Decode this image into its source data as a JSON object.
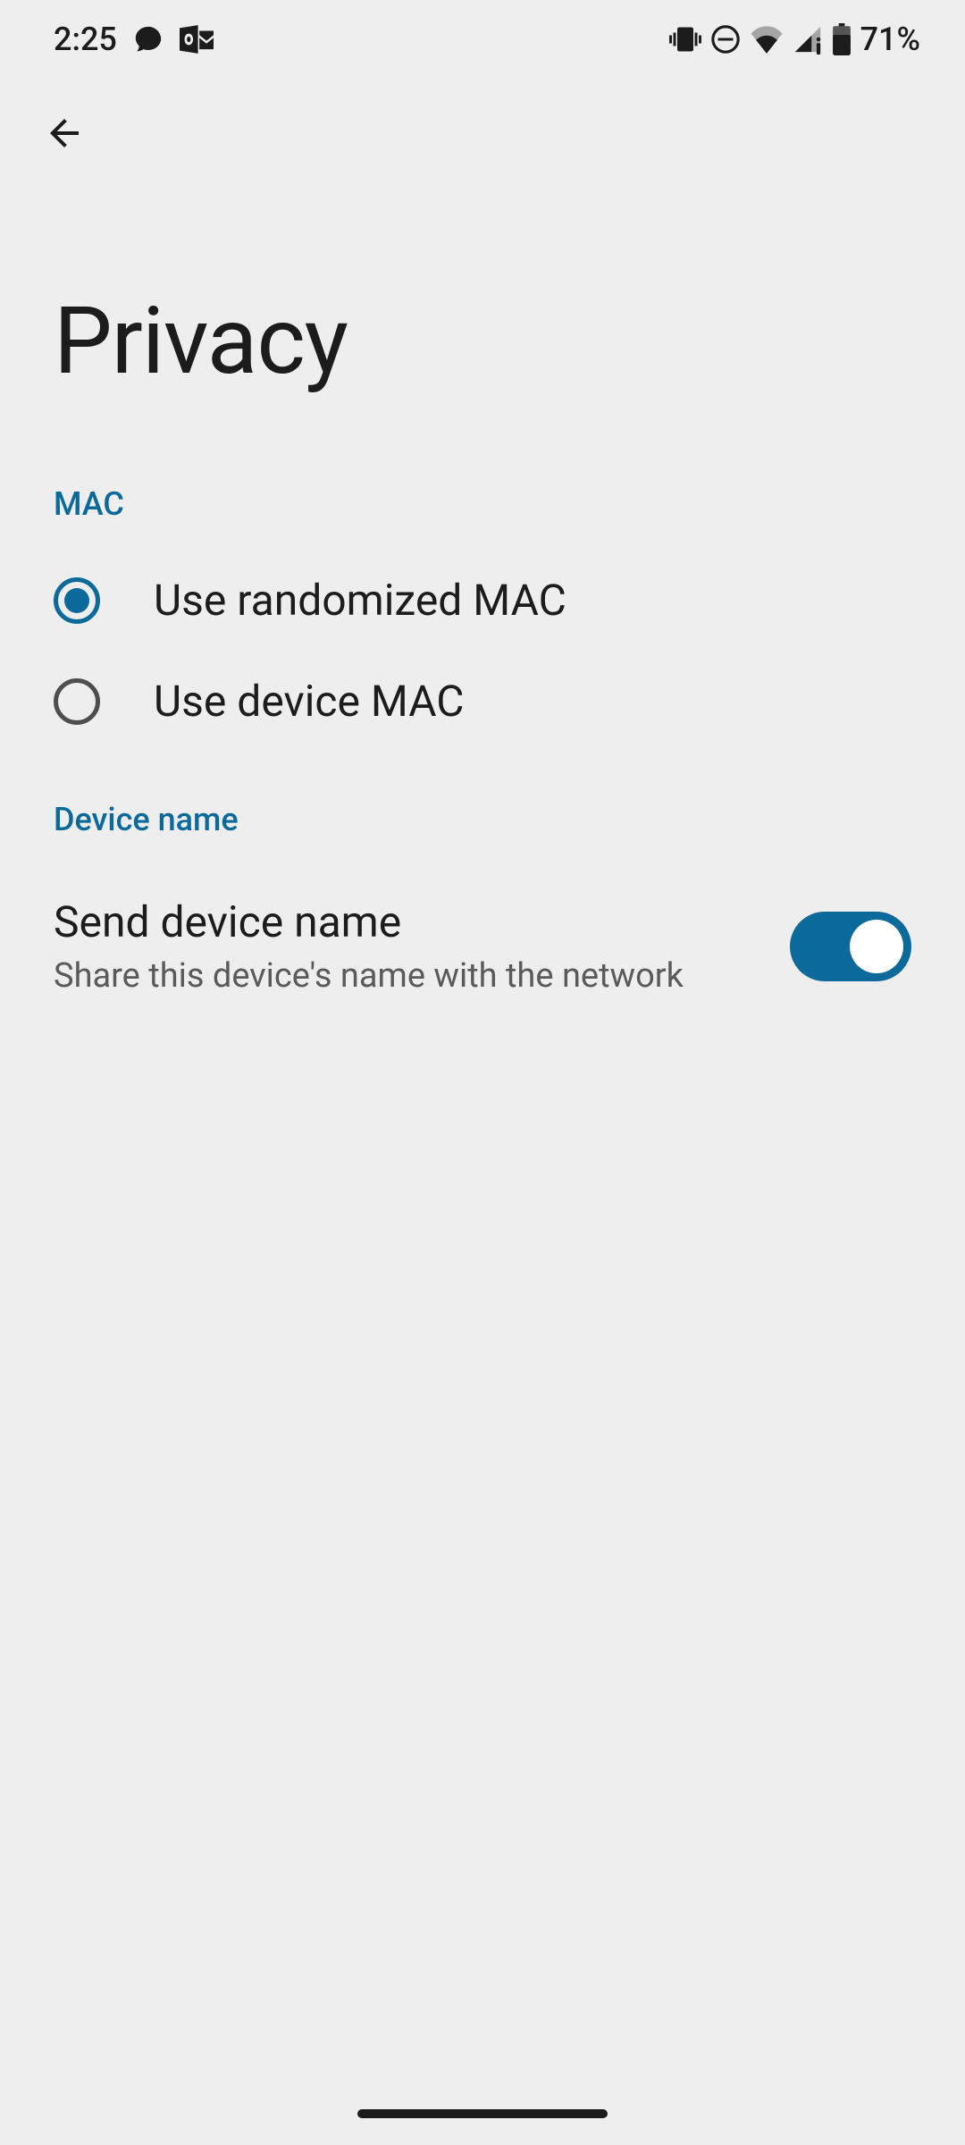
{
  "status_bar": {
    "time": "2:25",
    "battery_pct": "71%"
  },
  "page": {
    "title": "Privacy"
  },
  "sections": {
    "mac": {
      "header": "MAC",
      "options": [
        {
          "label": "Use randomized MAC",
          "selected": true
        },
        {
          "label": "Use device MAC",
          "selected": false
        }
      ]
    },
    "device_name": {
      "header": "Device name",
      "switch": {
        "title": "Send device name",
        "subtitle": "Share this device's name with the network",
        "enabled": true
      }
    }
  },
  "colors": {
    "accent": "#0b6a9a",
    "background": "#eeeeee",
    "text_primary": "#1c1c1c",
    "text_secondary": "#5a5a5a"
  }
}
